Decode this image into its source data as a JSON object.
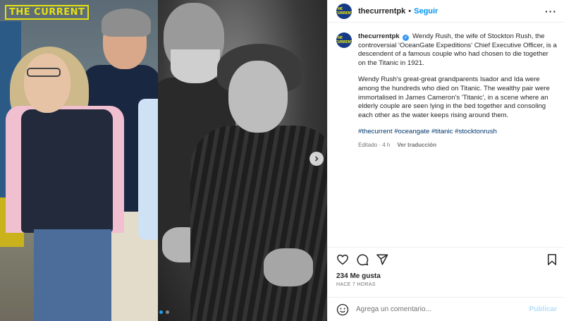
{
  "media": {
    "watermark": "THE CURRENT",
    "next_icon": "chevron-right-icon",
    "carousel": {
      "count": 2,
      "active_index": 0
    }
  },
  "header": {
    "username": "thecurrentpk",
    "separator": "•",
    "follow_label": "Seguir",
    "more_icon": "more-horizontal-icon",
    "more_label": "···",
    "avatar_text": "THE CURRENT"
  },
  "caption": {
    "username": "thecurrentpk",
    "verified_label": "✓",
    "paragraph_1": "Wendy Rush, the wife of Stockton Rush, the controversial 'OceanGate Expeditions' Chief Executive Officer, is a descendent of a famous couple who had chosen to die together on the Titanic in 1921.",
    "paragraph_2": "Wendy Rush's great-great grandparents Isador and Ida were among the hundreds who died on Titanic. The wealthy pair were immortalised in James Cameron's 'Titanic', in a scene where an elderly couple are seen lying in the bed together and consoling each other as the water keeps rising around them.",
    "hashtags": [
      "#thecurrent",
      "#oceangate",
      "#titanic",
      "#stocktonrush"
    ],
    "edited_label": "Editado · 4 h",
    "see_translation": "Ver traducción"
  },
  "actions": {
    "like_icon": "heart-icon",
    "comment_icon": "comment-icon",
    "share_icon": "send-icon",
    "save_icon": "bookmark-icon"
  },
  "likes": "234 Me gusta",
  "time_ago": "HACE 7 HORAS",
  "comment": {
    "emoji_icon": "emoji-icon",
    "placeholder": "Agrega un comentario...",
    "value": "",
    "publish_label": "Publicar"
  },
  "colors": {
    "accent": "#0095f6",
    "hashtag": "#00376b",
    "muted": "#737373",
    "watermark": "#e4e013",
    "avatar_bg": "#173a86"
  }
}
